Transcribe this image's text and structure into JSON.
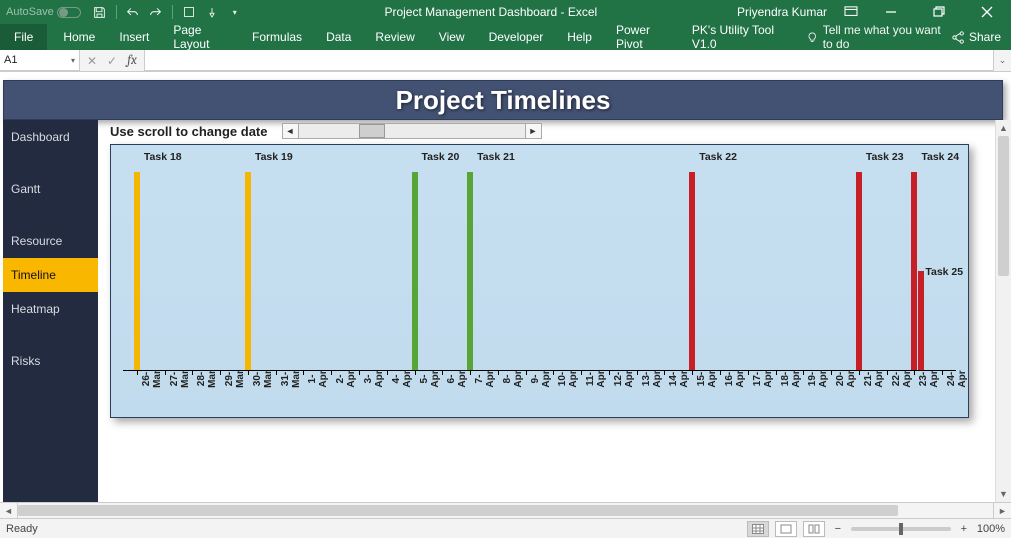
{
  "titlebar": {
    "autosave_label": "AutoSave",
    "title": "Project Management Dashboard  -  Excel",
    "user": "Priyendra Kumar"
  },
  "ribbon": {
    "file": "File",
    "tabs": [
      "Home",
      "Insert",
      "Page Layout",
      "Formulas",
      "Data",
      "Review",
      "View",
      "Developer",
      "Help",
      "Power Pivot",
      "PK's Utility Tool V1.0"
    ],
    "tellme": "Tell me what you want to do",
    "share": "Share"
  },
  "formula": {
    "namebox": "A1"
  },
  "dashboard": {
    "banner": "Project Timelines",
    "sidebar": [
      "Dashboard",
      "Gantt",
      "Resource",
      "Timeline",
      "Heatmap",
      "Risks"
    ],
    "sidebar_active": 3,
    "instruction": "Use scroll to change date"
  },
  "chart_data": {
    "type": "bar",
    "xlabel": "",
    "ylabel": "",
    "categories": [
      "26-Mar",
      "27-Mar",
      "28-Mar",
      "29-Mar",
      "30-Mar",
      "31-Mar",
      "1-Apr",
      "2-Apr",
      "3-Apr",
      "4-Apr",
      "5-Apr",
      "6-Apr",
      "7-Apr",
      "8-Apr",
      "9-Apr",
      "10-Apr",
      "11-Apr",
      "12-Apr",
      "13-Apr",
      "14-Apr",
      "15-Apr",
      "16-Apr",
      "17-Apr",
      "18-Apr",
      "19-Apr",
      "20-Apr",
      "21-Apr",
      "22-Apr",
      "23-Apr",
      "24-Apr"
    ],
    "series": [
      {
        "name": "Task 18",
        "date": "26-Mar",
        "color": "orange",
        "height": 1.0
      },
      {
        "name": "Task 19",
        "date": "30-Mar",
        "color": "orange",
        "height": 1.0
      },
      {
        "name": "Task 20",
        "date": "5-Apr",
        "color": "green",
        "height": 1.0
      },
      {
        "name": "Task 21",
        "date": "7-Apr",
        "color": "green",
        "height": 1.0
      },
      {
        "name": "Task 22",
        "date": "15-Apr",
        "color": "red",
        "height": 1.0
      },
      {
        "name": "Task 23",
        "date": "21-Apr",
        "color": "red",
        "height": 1.0
      },
      {
        "name": "Task 24",
        "date": "23-Apr",
        "color": "red",
        "height": 1.0
      },
      {
        "name": "Task 25",
        "date": "23-Apr",
        "color": "red",
        "height": 0.5
      }
    ]
  },
  "status": {
    "ready": "Ready",
    "zoom": "100%"
  }
}
